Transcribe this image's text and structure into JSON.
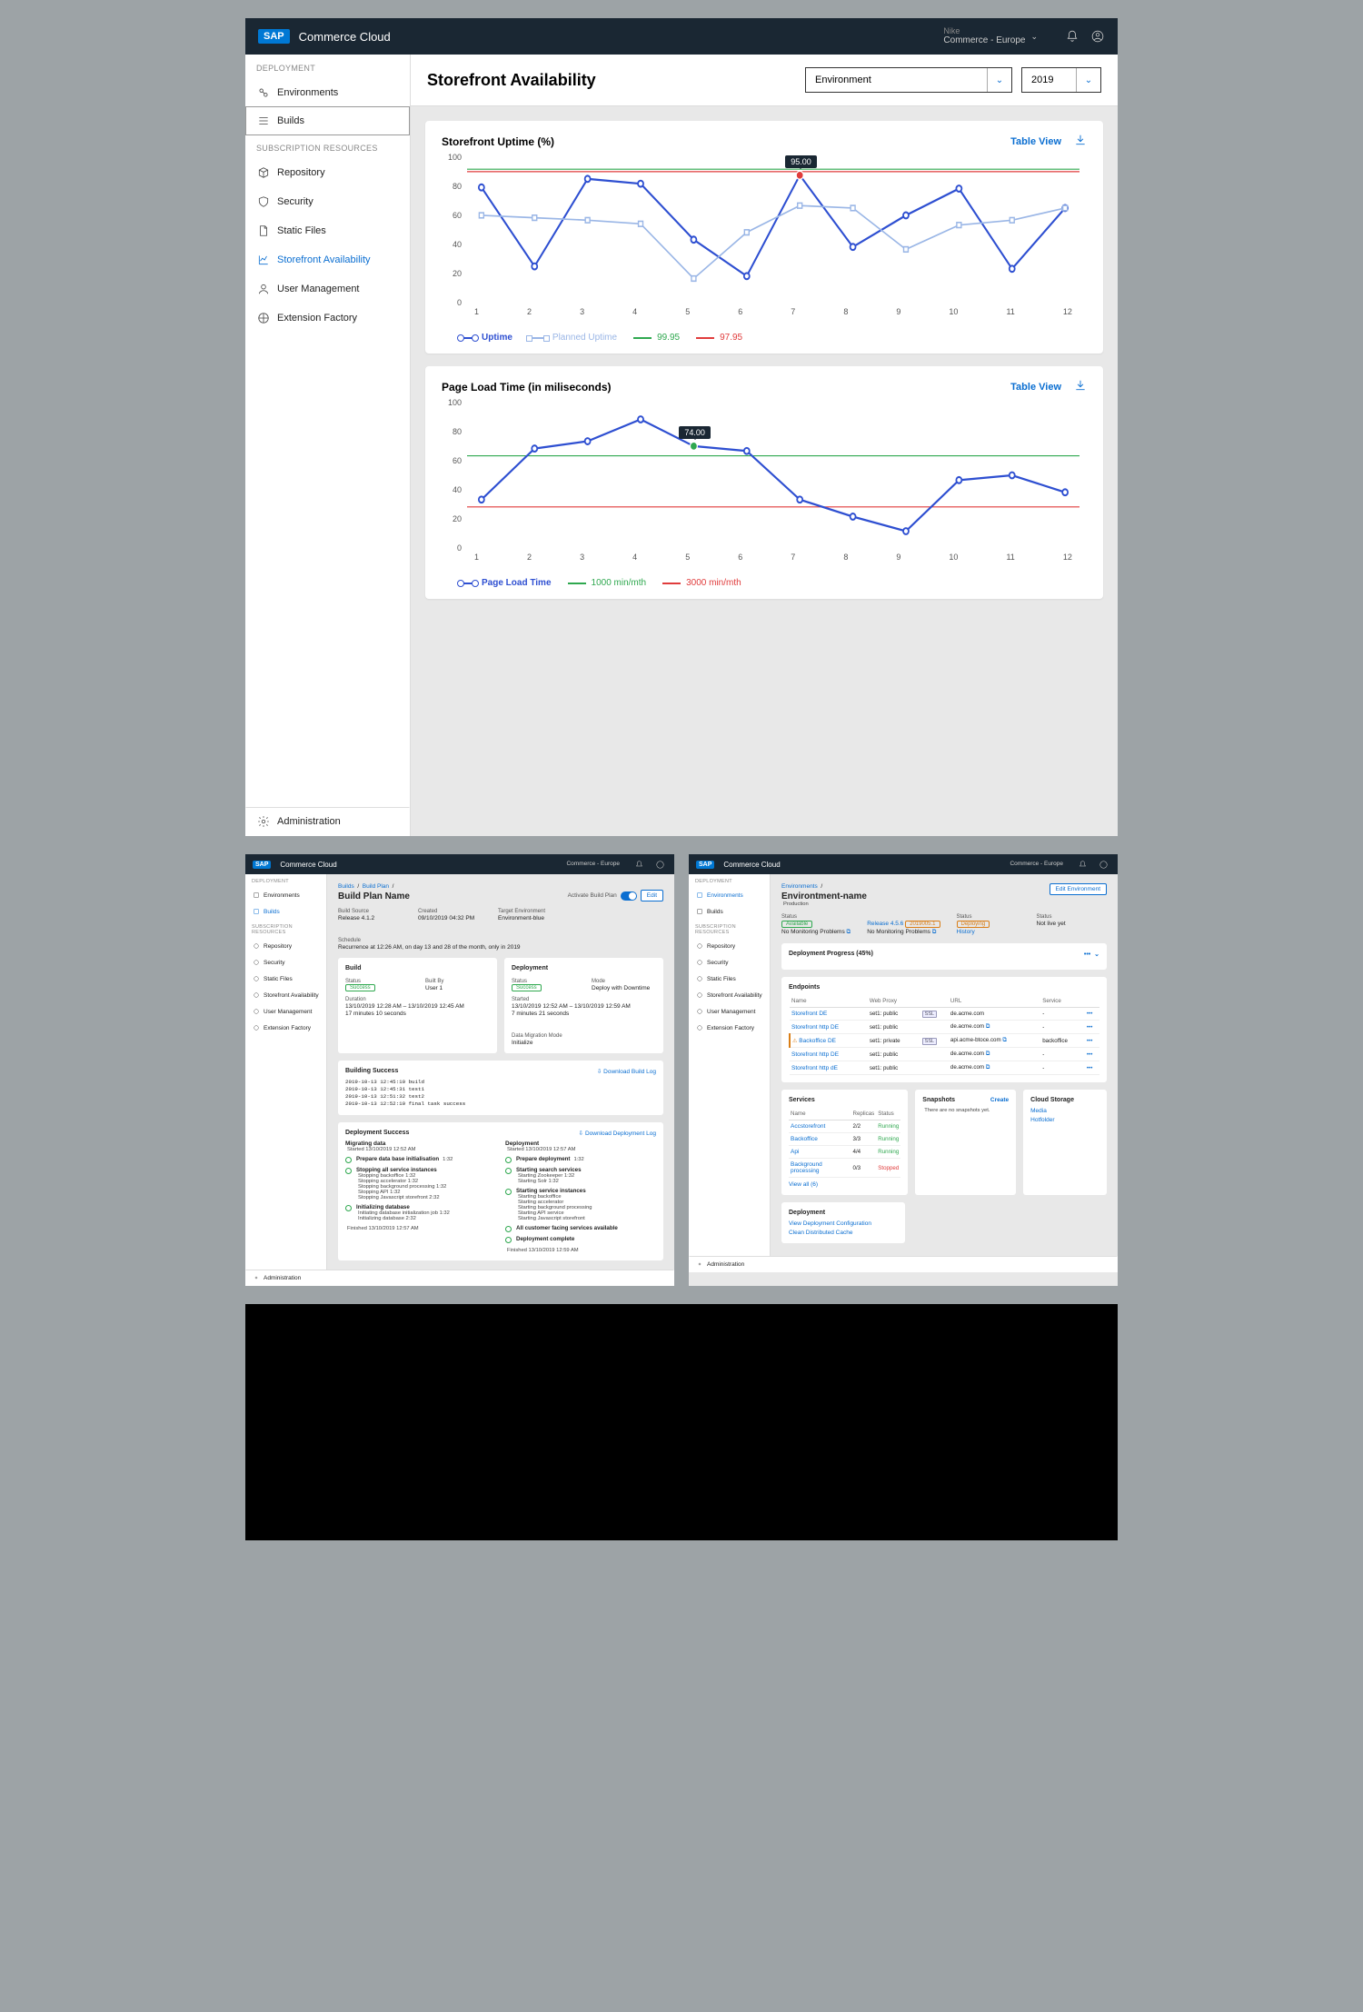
{
  "brand": {
    "logo": "SAP",
    "product": "Commerce Cloud"
  },
  "tenant": {
    "line1": "Nike",
    "line2": "Commerce - Europe"
  },
  "sidebar": {
    "section1": "DEPLOYMENT",
    "items1": [
      "Environments",
      "Builds"
    ],
    "section2": "SUBSCRIPTION RESOURCES",
    "items2": [
      "Repository",
      "Security",
      "Static Files",
      "Storefront Availability",
      "User Management",
      "Extension Factory"
    ],
    "admin": "Administration"
  },
  "page": {
    "title": "Storefront Availability",
    "env_select": "Environment",
    "year_select": "2019",
    "table_view": "Table View"
  },
  "chart_data": [
    {
      "type": "line",
      "title": "Storefront Uptime (%)",
      "xlabel": "",
      "ylabel": "",
      "ylim": [
        0,
        100
      ],
      "x": [
        1,
        2,
        3,
        4,
        5,
        6,
        7,
        8,
        9,
        10,
        11,
        12
      ],
      "series": [
        {
          "name": "Uptime",
          "values": [
            85,
            20,
            92,
            88,
            42,
            12,
            95,
            36,
            62,
            84,
            18,
            68
          ]
        },
        {
          "name": "Planned Uptime",
          "values": [
            62,
            60,
            58,
            55,
            10,
            48,
            70,
            68,
            34,
            54,
            58,
            68
          ]
        }
      ],
      "ref_lines": [
        {
          "name": "99.95",
          "value": 99.95,
          "color": "#2fa84f"
        },
        {
          "name": "97.95",
          "value": 97.95,
          "color": "#e03c3c"
        }
      ],
      "annotation": {
        "x": 7,
        "value": 95.0,
        "label": "95.00"
      }
    },
    {
      "type": "line",
      "title": "Page Load Time (in miliseconds)",
      "xlabel": "",
      "ylabel": "",
      "ylim": [
        0,
        100
      ],
      "x": [
        1,
        2,
        3,
        4,
        5,
        6,
        7,
        8,
        9,
        10,
        11,
        12
      ],
      "series": [
        {
          "name": "Page Load Time",
          "values": [
            30,
            72,
            78,
            96,
            74,
            70,
            30,
            16,
            4,
            46,
            50,
            36
          ]
        }
      ],
      "ref_lines": [
        {
          "name": "1000 min/mth",
          "value": 66,
          "color": "#2fa84f"
        },
        {
          "name": "3000 min/mth",
          "value": 24,
          "color": "#e03c3c"
        }
      ],
      "annotation": {
        "x": 5,
        "value": 74.0,
        "label": "74.00"
      }
    }
  ],
  "legend_strings": {
    "uptime": "Uptime",
    "planned": "Planned Uptime",
    "g9995": "99.95",
    "g9795": "97.95",
    "plt": "Page Load Time",
    "l1000": "1000 min/mth",
    "l3000": "3000 min/mth"
  },
  "thumb_build": {
    "crumbs": [
      "Builds",
      "Build Plan"
    ],
    "title": "Build Plan Name",
    "activate": "Activate Build Plan",
    "edit": "Edit",
    "meta": [
      {
        "l": "Build Source",
        "v": "Release 4.1.2"
      },
      {
        "l": "Created",
        "v": "09/10/2019 04:32 PM"
      },
      {
        "l": "Target Environment",
        "v": "Environment-blue"
      },
      {
        "l": "Schedule",
        "v": "Recurrence at 12:26 AM, on day 13 and 28 of the month, only in 2019"
      }
    ],
    "build_card": {
      "title": "Build",
      "status_l": "Status",
      "status_v": "Success",
      "builtby_l": "Built By",
      "builtby_v": "User 1",
      "dur_l": "Duration",
      "dur_v": "13/10/2019 12:28 AM – 13/10/2019 12:45 AM",
      "dur_v2": "17 minutes 10 seconds"
    },
    "deploy_card": {
      "title": "Deployment",
      "status_l": "Status",
      "status_v": "Success",
      "mode_l": "Mode",
      "mode_v": "Deploy with Downtime",
      "started_l": "Started",
      "started_v": "13/10/2019 12:52 AM – 13/10/2019 12:59 AM",
      "started_v2": "7 minutes 21 seconds",
      "dm_l": "Data Migration Mode",
      "dm_v": "Initialize"
    },
    "building": {
      "title": "Building Success",
      "dl": "Download Build Log",
      "log": [
        "2019-10-13 12:45:10 build",
        "2019-10-13 12:45:31 test1",
        "2019-10-13 12:51:32 test2",
        "2019-10-13 12:52:10 final task success"
      ]
    },
    "deploy_success": {
      "title": "Deployment Success",
      "dl": "Download Deployment Log",
      "left_title": "Migrating data",
      "left_started": "Started 13/10/2019 12:52 AM",
      "right_title": "Deployment",
      "right_started": "Started 13/10/2019 12:57 AM",
      "left_steps": [
        {
          "t": "Prepare data base initialisation",
          "d": "1:32"
        },
        {
          "t": "Stopping all service instances",
          "subs": [
            "Stopping backoffice  1:32",
            "Stopping accelerator  1:32",
            "Stopping background processing  1:32",
            "Stopping API  1:32",
            "Stopping Javascript storefront  2:32"
          ]
        },
        {
          "t": "Initializing database",
          "subs": [
            "Initiating database initialization job  1:32",
            "Initializing database  2:32"
          ]
        }
      ],
      "left_footer": "Finished 13/10/2019 12:57 AM",
      "right_steps": [
        {
          "t": "Prepare deployment",
          "d": "1:32"
        },
        {
          "t": "Starting search services",
          "subs": [
            "Starting Zookeeper  1:32",
            "Starting Solr  1:32"
          ]
        },
        {
          "t": "Starting service instances",
          "subs": [
            "Starting backoffice",
            "Starting accelerator",
            "Starting background processing",
            "Starting API service",
            "Starting Javascript storefront"
          ]
        },
        {
          "t": "All customer facing services available"
        },
        {
          "t": "Deployment complete"
        }
      ],
      "right_footer": "Finished 13/10/2019 12:59 AM"
    }
  },
  "thumb_env": {
    "crumbs": [
      "Environments"
    ],
    "title": "Environtment-name",
    "subtitle": "Production",
    "edit": "Edit Environment",
    "status_cols": [
      {
        "l": "Status",
        "v": "Available",
        "ext": "No Monitoring Problems",
        "pill": "green",
        "link": true
      },
      {
        "l": "",
        "v": "Release 4.5.6",
        "v2": "2019005.1",
        "ext": "No Monitoring Problems",
        "link": true,
        "pill2": "orange"
      },
      {
        "l": "Status",
        "v": "Deploying",
        "ext": "History",
        "pill": "orange",
        "extlink": true
      },
      {
        "l": "Status",
        "v": "Not live yet"
      }
    ],
    "progress": {
      "title": "Deployment Progress (45%)"
    },
    "endpoints": {
      "title": "Endpoints",
      "headers": [
        "Name",
        "Web Proxy",
        "",
        "URL",
        "Service",
        ""
      ],
      "rows": [
        {
          "name": "Storefront DE",
          "proxy": "set1: public",
          "ssl": "SSL",
          "url": "de.acme.com",
          "svc": "-",
          "link": true
        },
        {
          "name": "Storefront http DE",
          "proxy": "set1: public",
          "ssl": "",
          "url": "de.acme.com",
          "svc": "-",
          "link": true,
          "ext": true
        },
        {
          "name": "Backoffice DE",
          "proxy": "set1: private",
          "ssl": "SSL",
          "url": "api.acme-btoce.com",
          "svc": "backoffice",
          "link": true,
          "warn": true,
          "ext": true
        },
        {
          "name": "Storefront http DE",
          "proxy": "set1: public",
          "ssl": "",
          "url": "de.acme.com",
          "svc": "-",
          "link": true,
          "ext": true
        },
        {
          "name": "Storefront http dE",
          "proxy": "set1: public",
          "ssl": "",
          "url": "de.acme.com",
          "svc": "-",
          "link": true,
          "ext": true
        }
      ]
    },
    "services": {
      "title": "Services",
      "headers": [
        "Name",
        "Replicas",
        "Status"
      ],
      "rows": [
        {
          "name": "Accstorefront",
          "rep": "2/2",
          "st": "Running",
          "cls": "run"
        },
        {
          "name": "Backoffice",
          "rep": "3/3",
          "st": "Running",
          "cls": "run"
        },
        {
          "name": "Api",
          "rep": "4/4",
          "st": "Running",
          "cls": "run"
        },
        {
          "name": "Background processing",
          "rep": "0/3",
          "st": "Stopped",
          "cls": "stop"
        }
      ],
      "viewall": "View all (6)"
    },
    "snapshots": {
      "title": "Snapshots",
      "create": "Create",
      "empty": "There are no snapshots yet."
    },
    "cloud": {
      "title": "Cloud Storage",
      "items": [
        "Media",
        "Hotfolder"
      ]
    },
    "deploy_links": {
      "title": "Deployment",
      "items": [
        "View Deployment Configuration",
        "Clean Distributed Cache"
      ]
    }
  }
}
